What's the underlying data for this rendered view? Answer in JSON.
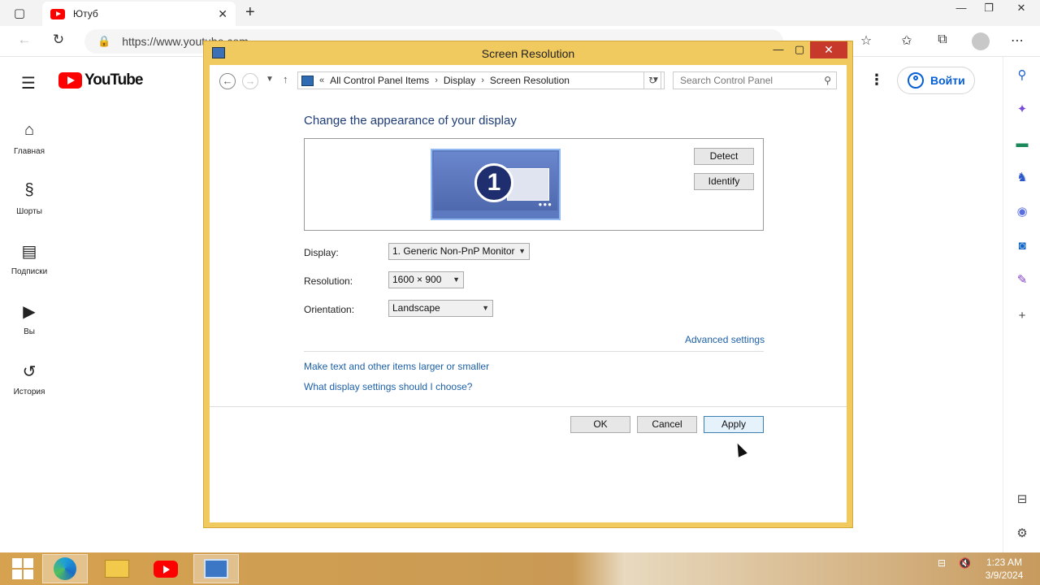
{
  "browser": {
    "tab_title": "Ютуб",
    "url": "https://www.youtube.com"
  },
  "youtube": {
    "logo_text": "YouTube",
    "nav": [
      {
        "label": "Главная",
        "icon": "home-icon"
      },
      {
        "label": "Шорты",
        "icon": "shorts-icon"
      },
      {
        "label": "Подписки",
        "icon": "subscriptions-icon"
      },
      {
        "label": "Вы",
        "icon": "you-icon"
      },
      {
        "label": "История",
        "icon": "history-icon"
      }
    ],
    "login_label": "Войти",
    "accent": "#ff0000"
  },
  "dialog": {
    "title": "Screen Resolution",
    "breadcrumb": [
      "All Control Panel Items",
      "Display",
      "Screen Resolution"
    ],
    "search_placeholder": "Search Control Panel",
    "heading": "Change the appearance of your display",
    "monitor_number": "1",
    "detect_label": "Detect",
    "identify_label": "Identify",
    "display_label": "Display:",
    "display_value": "1. Generic Non-PnP Monitor",
    "resolution_label": "Resolution:",
    "resolution_value": "1600 × 900",
    "orientation_label": "Orientation:",
    "orientation_value": "Landscape",
    "advanced_link": "Advanced settings",
    "link_text_size": "Make text and other items larger or smaller",
    "link_settings_help": "What display settings should I choose?",
    "ok_label": "OK",
    "cancel_label": "Cancel",
    "apply_label": "Apply"
  },
  "taskbar": {
    "time": "1:23 AM",
    "date": "3/9/2024"
  }
}
